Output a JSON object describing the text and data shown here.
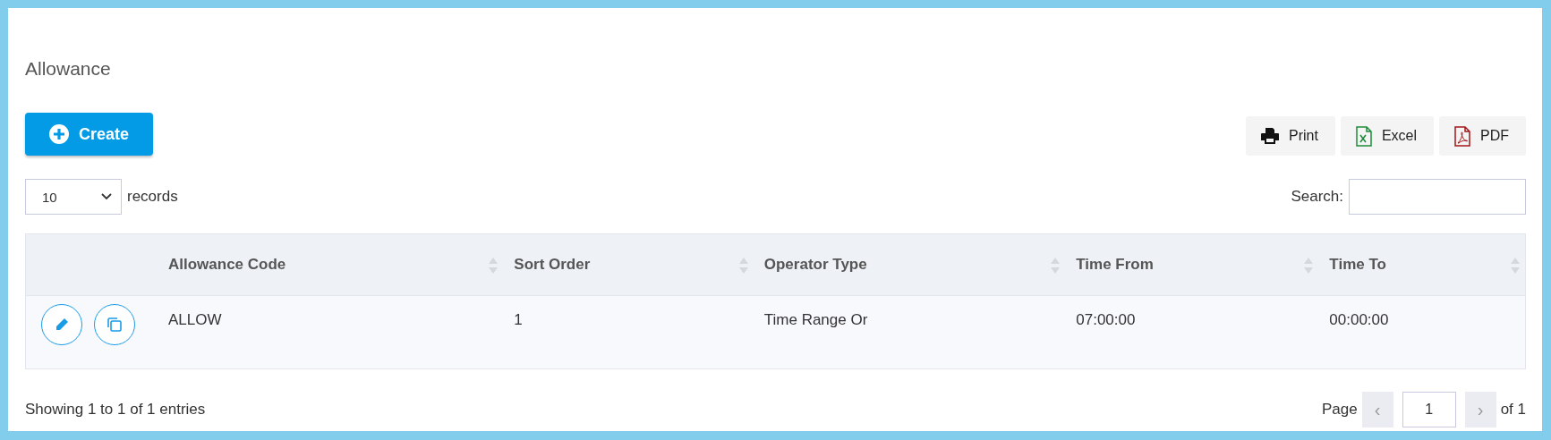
{
  "page_title": "Allowance",
  "create_button": "Create",
  "export_buttons": [
    {
      "kind": "print",
      "label": "Print"
    },
    {
      "kind": "excel",
      "label": "Excel"
    },
    {
      "kind": "pdf",
      "label": "PDF"
    }
  ],
  "length_select": {
    "value": "10",
    "label": "records"
  },
  "search": {
    "label": "Search:"
  },
  "table": {
    "columns": [
      "Allowance Code",
      "Sort Order",
      "Operator Type",
      "Time From",
      "Time To"
    ],
    "rows": [
      {
        "cells": [
          "ALLOW",
          "1",
          "Time Range Or",
          "07:00:00",
          "00:00:00"
        ]
      }
    ]
  },
  "info": "Showing 1 to 1 of 1 entries",
  "pagination": {
    "page_label": "Page",
    "prev": "‹",
    "current": "1",
    "next": "›",
    "of_label": "of 1"
  }
}
